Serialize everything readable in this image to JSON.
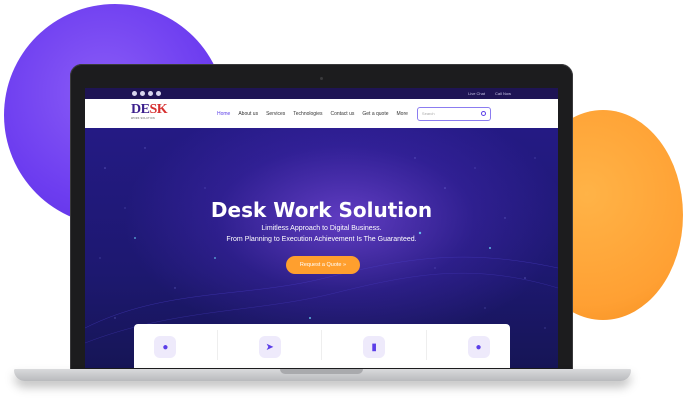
{
  "topbar": {
    "social_icons": [
      "instagram-icon",
      "facebook-icon",
      "twitter-icon",
      "pinterest-icon"
    ],
    "live_chat": "Live Chat",
    "call_now": "Call Now"
  },
  "logo": {
    "text_main": "DE",
    "text_k": "SK",
    "subtitle": "WORK SOLUTION"
  },
  "nav": {
    "items": [
      "Home",
      "About us",
      "Services",
      "Technologies",
      "Contact us",
      "Get a quote",
      "More"
    ],
    "active": "Home"
  },
  "search": {
    "placeholder": "Search"
  },
  "hero": {
    "title": "Desk Work Solution",
    "subtitle_1": "Limitless Approach to Digital Business.",
    "subtitle_2": "From Planning to Execution Achievement Is The Guaranteed.",
    "cta": "Request a Quote  »"
  },
  "cards": {
    "icons": [
      "team-icon",
      "rocket-icon",
      "tools-icon",
      "group-icon"
    ]
  },
  "colors": {
    "accent": "#5b3ee8",
    "cta": "#ff9f2e",
    "hero_bg": "#1e1670"
  }
}
